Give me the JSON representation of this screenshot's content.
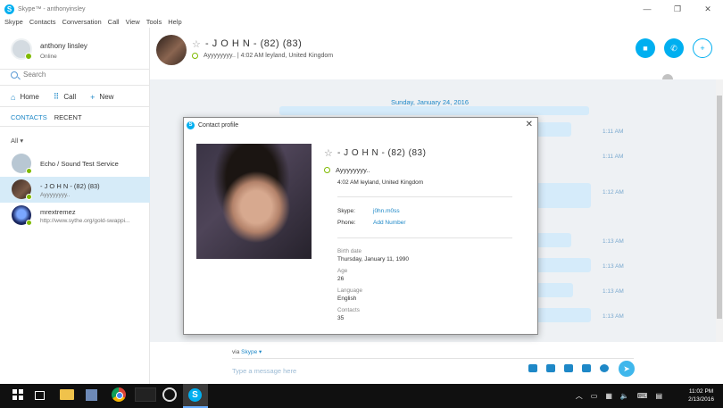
{
  "window": {
    "title": "Skype™ - anthonyinsley"
  },
  "menu": [
    "Skype",
    "Contacts",
    "Conversation",
    "Call",
    "View",
    "Tools",
    "Help"
  ],
  "profile": {
    "name": "anthony linsley",
    "status": "Online"
  },
  "search": {
    "placeholder": "Search"
  },
  "nav": {
    "home": "Home",
    "call": "Call",
    "new": "New"
  },
  "tabs": {
    "contacts": "CONTACTS",
    "recent": "RECENT"
  },
  "filter": "All ▾",
  "contacts": [
    {
      "name": "Echo / Sound Test Service",
      "mood": ""
    },
    {
      "name": "- J O H N - (82) (83)",
      "mood": "Ayyyyyyyy.."
    },
    {
      "name": "mrextremez",
      "mood": "http://www.sythe.org/gold-swappi..."
    }
  ],
  "chat_header": {
    "name": "- J O H N - (82) (83)",
    "status": "Ayyyyyyyy..  |  4:02 AM leyland, United Kingdom"
  },
  "chat": {
    "date": "Sunday, January 24, 2016",
    "timestamps": [
      "1:11 AM",
      "1:11 AM",
      "1:12 AM",
      "1:13 AM",
      "1:13 AM",
      "1:13 AM",
      "1:13 AM"
    ]
  },
  "compose": {
    "via_prefix": "via",
    "via_link": "Skype ▾",
    "placeholder": "Type a message here"
  },
  "dialog": {
    "title": "Contact profile",
    "name": "- J O H N - (82) (83)",
    "mood": "Ayyyyyyyy..",
    "location": "4:02 AM leyland, United Kingdom",
    "skype_label": "Skype:",
    "skype_value": "j0hn.m0ss",
    "phone_label": "Phone:",
    "phone_value": "Add Number",
    "birth_label": "Birth date",
    "birth_value": "Thursday, January 11, 1990",
    "age_label": "Age",
    "age_value": "26",
    "language_label": "Language",
    "language_value": "English",
    "contacts_label": "Contacts",
    "contacts_value": "35"
  },
  "taskbar": {
    "time": "11:02 PM",
    "date": "2/13/2016"
  },
  "colors": {
    "accent": "#00aff0",
    "link": "#1e88c7",
    "online": "#7fba00",
    "selected": "#d6ebf8"
  }
}
